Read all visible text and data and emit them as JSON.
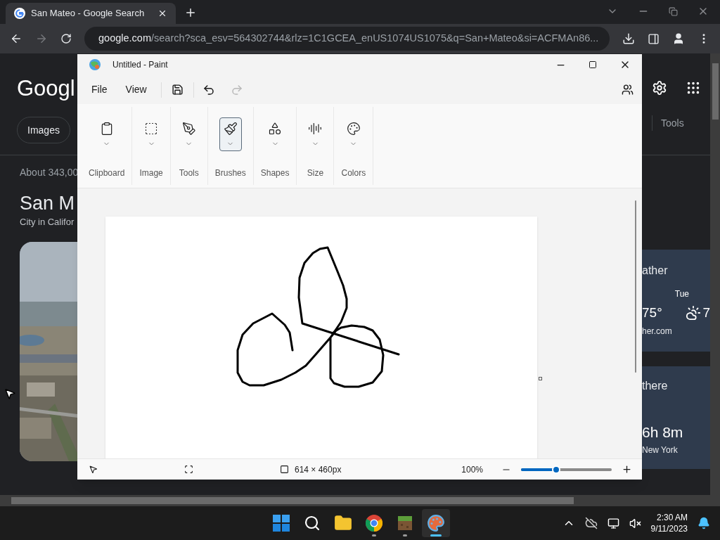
{
  "browser": {
    "tabs": [
      {
        "title": "San Mateo - Google Search",
        "selected": true
      }
    ],
    "url": {
      "domain": "google.com",
      "path": "/search?sca_esv=564302744&rlz=1C1GCEA_enUS1074US1075&q=San+Mateo&si=ACFMAn86..."
    }
  },
  "google": {
    "logo": "Googl",
    "chips": [
      {
        "label": "Images"
      }
    ],
    "tools": "Tools",
    "result_count": "About 343,00",
    "title": "San M",
    "subtitle": "City in Califor",
    "weather": {
      "heading": "ather",
      "day": "Tue",
      "temp": "75°",
      "day_temp": "7",
      "source": "her.com"
    },
    "travel": {
      "heading": "there",
      "duration": "6h 8m",
      "place": "New York"
    }
  },
  "paint": {
    "title": "Untitled - Paint",
    "menu": [
      {
        "label": "File"
      },
      {
        "label": "View"
      }
    ],
    "groups": [
      {
        "label": "Clipboard",
        "kind": "clipboard",
        "selected": false
      },
      {
        "label": "Image",
        "selected": false
      },
      {
        "label": "Tools",
        "kind": "tools",
        "selected": false
      },
      {
        "label": "Brushes",
        "kind": "brushes",
        "selected": true
      },
      {
        "label": "Shapes",
        "kind": "shapes",
        "selected": false
      },
      {
        "label": "Size",
        "kind": "size",
        "selected": false
      },
      {
        "label": "Colors",
        "kind": "colors",
        "selected": false
      }
    ],
    "status": {
      "canvas_size": "614 × 460px",
      "zoom": "100%",
      "level": 0.39
    }
  },
  "taskbar": {
    "apps": [
      {
        "kind": "start",
        "running": false,
        "active": false
      },
      {
        "kind": "search",
        "running": false,
        "active": false
      },
      {
        "kind": "explorer",
        "running": false,
        "active": false
      },
      {
        "kind": "chrome",
        "running": true,
        "active": false
      },
      {
        "kind": "minecraft",
        "running": true,
        "active": false
      },
      {
        "kind": "paint",
        "running": true,
        "active": true
      }
    ],
    "time": "2:30 AM",
    "date": "9/11/2023"
  }
}
